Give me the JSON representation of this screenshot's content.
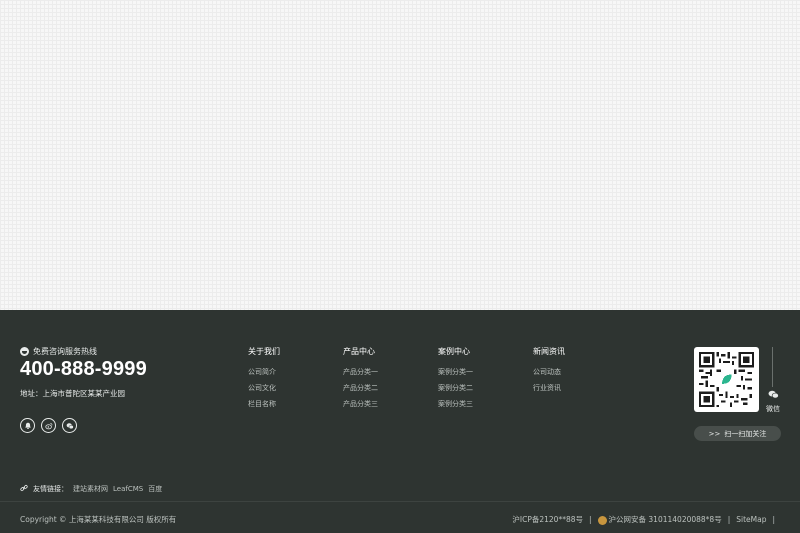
{
  "contact": {
    "hotline_label": "免费咨询服务热线",
    "phone": "400-888-9999",
    "address": "地址：上海市普陀区某某产业园"
  },
  "socials": [
    {
      "name": "qq-icon",
      "glyph": "🔔"
    },
    {
      "name": "weibo-icon",
      "glyph": "◉"
    },
    {
      "name": "wechat-icon",
      "glyph": "◎"
    }
  ],
  "nav": [
    {
      "title": "关于我们",
      "links": [
        "公司简介",
        "公司文化",
        "栏目名称"
      ]
    },
    {
      "title": "产品中心",
      "links": [
        "产品分类一",
        "产品分类二",
        "产品分类三"
      ]
    },
    {
      "title": "案例中心",
      "links": [
        "案例分类一",
        "案例分类二",
        "案例分类三"
      ]
    },
    {
      "title": "新闻资讯",
      "links": [
        "公司动态",
        "行业资讯"
      ]
    }
  ],
  "qr": {
    "side_label": "微信",
    "scan_button": "扫一扫加关注",
    "scan_prefix": ">>"
  },
  "friend_links": {
    "label": "友情链接：",
    "items": [
      "建站素材网",
      "LeafCMS",
      "百度"
    ]
  },
  "footer_bottom": {
    "copyright": "Copyright © 上海某某科技有限公司 版权所有",
    "icp": "沪ICP备2120**88号",
    "police": "沪公网安备 310114020088*8号",
    "sitemap": "SiteMap",
    "separator": "|"
  },
  "colors": {
    "footer_bg": "#2e3431",
    "police_badge": "#c8963e"
  }
}
